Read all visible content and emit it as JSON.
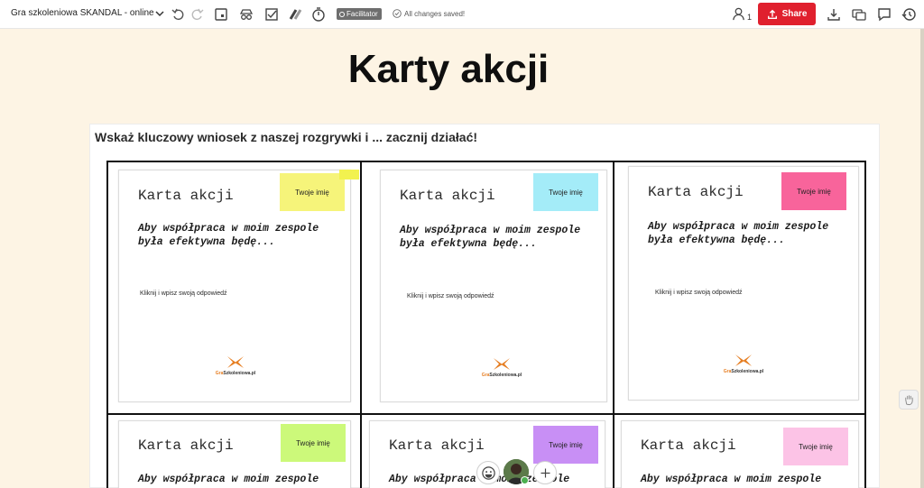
{
  "toolbar": {
    "board_title": "Gra szkoleniowa SKANDAL - online",
    "facilitator_label": "Facilitator",
    "saved_status": "All changes saved!",
    "user_count": "1",
    "share_label": "Share",
    "icons": [
      "chevron-down-icon",
      "undo-icon",
      "redo-icon",
      "frame-icon",
      "incognito-icon",
      "checklist-icon",
      "voting-icon",
      "timer-icon",
      "download-icon",
      "chat-icon",
      "comment-icon",
      "history-icon"
    ]
  },
  "page": {
    "heading": "Karty akcji",
    "prompt": "Wskaż kluczowy wniosek z naszej rozgrywki i ... zacznij działać!"
  },
  "cards": [
    {
      "title": "Karta akcji",
      "line1": "Aby współpraca w moim zespole",
      "line2": "była efektywna będę...",
      "hint": "Kliknij i wpisz swoją odpowiedź",
      "sticky": "Twoje imię",
      "sticky_color": "#f6f47a",
      "logo": "GraSzkoleniowa.pl"
    },
    {
      "title": "Karta akcji",
      "line1": "Aby współpraca w moim zespole",
      "line2": "była efektywna będę...",
      "hint": "Kliknij i wpisz swoją odpowiedź",
      "sticky": "Twoje imię",
      "sticky_color": "#a4ecf8",
      "logo": "GraSzkoleniowa.pl"
    },
    {
      "title": "Karta akcji",
      "line1": "Aby współpraca w moim zespole",
      "line2": "była efektywna będę...",
      "hint": "Kliknij i wpisz swoją odpowiedź",
      "sticky": "Twoje imię",
      "sticky_color": "#f8649b",
      "logo": "GraSzkoleniowa.pl"
    },
    {
      "title": "Karta akcji",
      "line1": "Aby współpraca w moim zespole",
      "sticky": "Twoje imię",
      "sticky_color": "#ccf97a"
    },
    {
      "title": "Karta akcji",
      "line1": "Aby współpraca w moim zespole",
      "sticky": "Twoje imię",
      "sticky_color": "#c88ff5"
    },
    {
      "title": "Karta akcji",
      "line1": "Aby współpraca w moim zespole",
      "sticky": "Twoje imię",
      "sticky_color": "#fcc3e6"
    }
  ],
  "colors": {
    "background": "#fdf4e4",
    "share": "#e0202e",
    "logo_orange": "#e67e22"
  }
}
